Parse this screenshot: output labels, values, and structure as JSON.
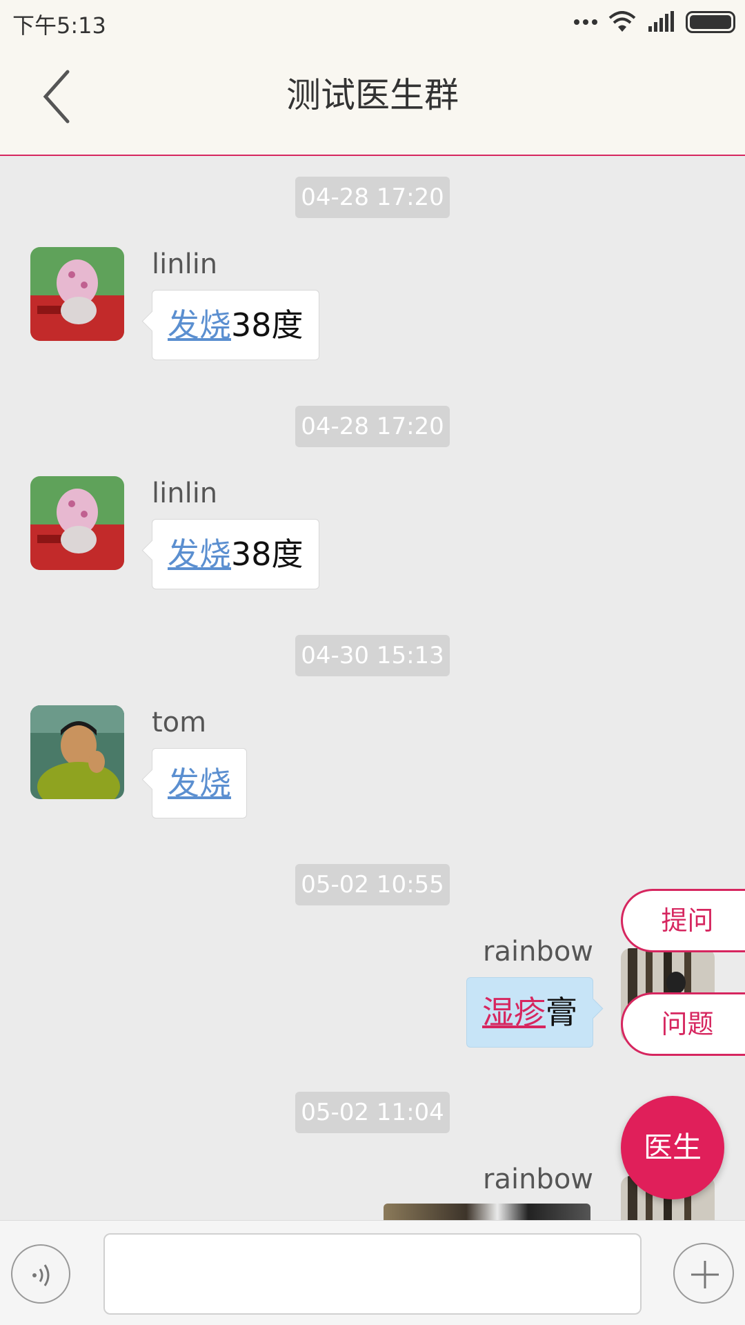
{
  "status_bar": {
    "time": "下午5:13"
  },
  "header": {
    "title": "测试医生群"
  },
  "messages": [
    {
      "timestamp": "04-28 17:20",
      "sender": "linlin",
      "keyword": "发烧",
      "text": "38度"
    },
    {
      "timestamp": "04-28 17:20",
      "sender": "linlin",
      "keyword": "发烧",
      "text": "38度"
    },
    {
      "timestamp": "04-30 15:13",
      "sender": "tom",
      "keyword": "发烧",
      "text": ""
    },
    {
      "timestamp": "05-02 10:55",
      "sender": "rainbow",
      "keyword": "湿疹",
      "text": "膏"
    },
    {
      "timestamp": "05-02 11:04",
      "sender": "rainbow"
    }
  ],
  "floating": {
    "ask_label": "提问",
    "question_label": "问题",
    "doctor_label": "医生"
  },
  "input_bar": {
    "placeholder": ""
  },
  "colors": {
    "accent": "#d6265f",
    "keyword_blue": "#5b8fd0",
    "bubble_self": "#c7e4f7"
  }
}
